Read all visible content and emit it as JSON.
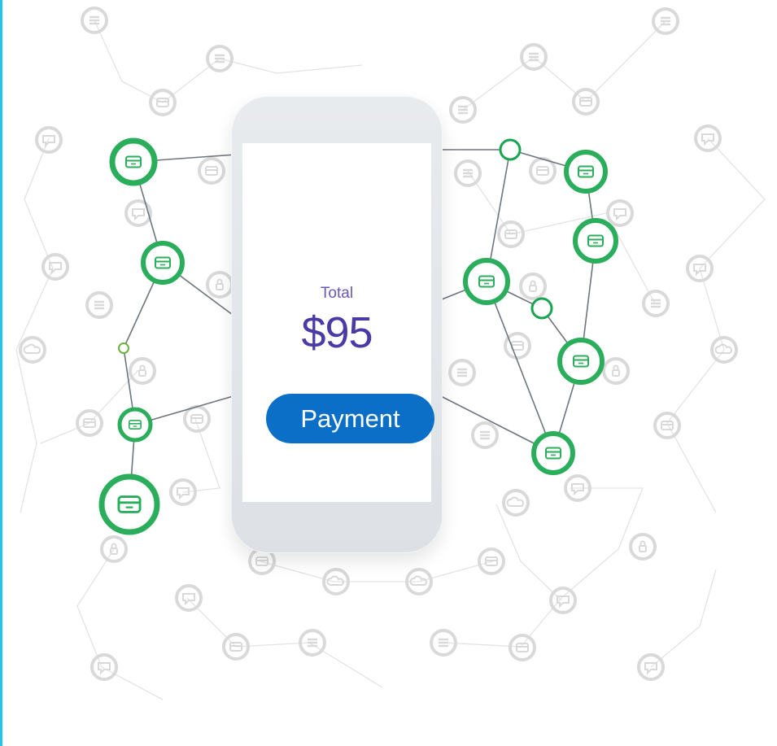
{
  "checkout": {
    "total_label": "Total",
    "amount": "$95",
    "payment_button": "Payment"
  },
  "colors": {
    "accent_bar": "#1ec8f0",
    "node_green": "#2aae5c",
    "amount_purple": "#4a3aa6",
    "button_blue": "#0b6fc8",
    "network_line": "#6d757d",
    "background_icon": "#d9d9d9"
  },
  "icons": [
    "card-icon",
    "list-icon",
    "chat-icon",
    "cloud-icon",
    "lock-icon"
  ]
}
